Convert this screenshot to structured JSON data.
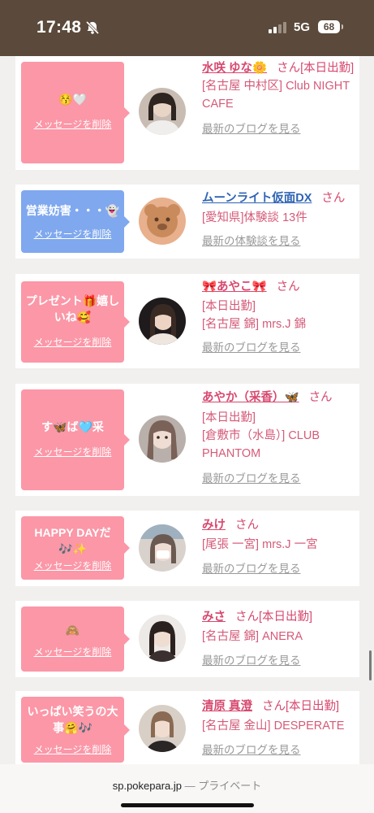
{
  "status": {
    "time": "17:48",
    "network": "5G",
    "battery": "68"
  },
  "feed": [
    {
      "bubble_color": "#fb97a7",
      "message": "😚🤍",
      "delete_label": "メッセージを削除",
      "name": "水咲 ゆな🌼",
      "san": "さん",
      "tag": "[本日出勤]",
      "details": [
        "[名古屋 中村区] Club NIGHT CAFE"
      ],
      "more": "最新のブログを見る"
    },
    {
      "bubble_color": "#7fa8ee",
      "message": "営業妨害・・・👻",
      "delete_label": "メッセージを削除",
      "name": "ムーンライト仮面DX",
      "san": "さん",
      "details": [
        "[愛知県]体験談 13件"
      ],
      "more": "最新の体験談を見る"
    },
    {
      "bubble_color": "#fb97a7",
      "message": "プレゼント🎁嬉しいね🥰",
      "delete_label": "メッセージを削除",
      "name": "🎀あやこ🎀",
      "san": "さん",
      "details": [
        "[本日出勤]",
        "[名古屋 錦] mrs.J 錦"
      ],
      "more": "最新のブログを見る"
    },
    {
      "bubble_color": "#fb97a7",
      "message": "す🦋ば🩵采",
      "delete_label": "メッセージを削除",
      "name": "あやか（采香）🦋",
      "san": "さん",
      "details": [
        "[本日出勤]",
        "[倉敷市（水島）] CLUB PHANTOM"
      ],
      "more": "最新のブログを見る"
    },
    {
      "bubble_color": "#fb97a7",
      "message": "HAPPY DAYだ🎶✨",
      "delete_label": "メッセージを削除",
      "name": "みけ",
      "san": "さん",
      "details": [
        "[尾張 一宮] mrs.J 一宮"
      ],
      "more": "最新のブログを見る"
    },
    {
      "bubble_color": "#fb97a7",
      "message": "🙈",
      "delete_label": "メッセージを削除",
      "name": "みさ",
      "san": "さん",
      "tag": "[本日出勤]",
      "details": [
        "[名古屋 錦] ANERA"
      ],
      "more": "最新のブログを見る"
    },
    {
      "bubble_color": "#fb97a7",
      "message": "いっぱい笑うの大事🤗🎶",
      "delete_label": "メッセージを削除",
      "name": "清原 真澄",
      "san": "さん",
      "tag": "[本日出勤]",
      "details": [
        "[名古屋 金山] DESPERATE"
      ],
      "more": "最新のブログを見る"
    }
  ],
  "address_bar": {
    "domain": "sp.pokepara.jp",
    "mode": "— プライベート"
  }
}
